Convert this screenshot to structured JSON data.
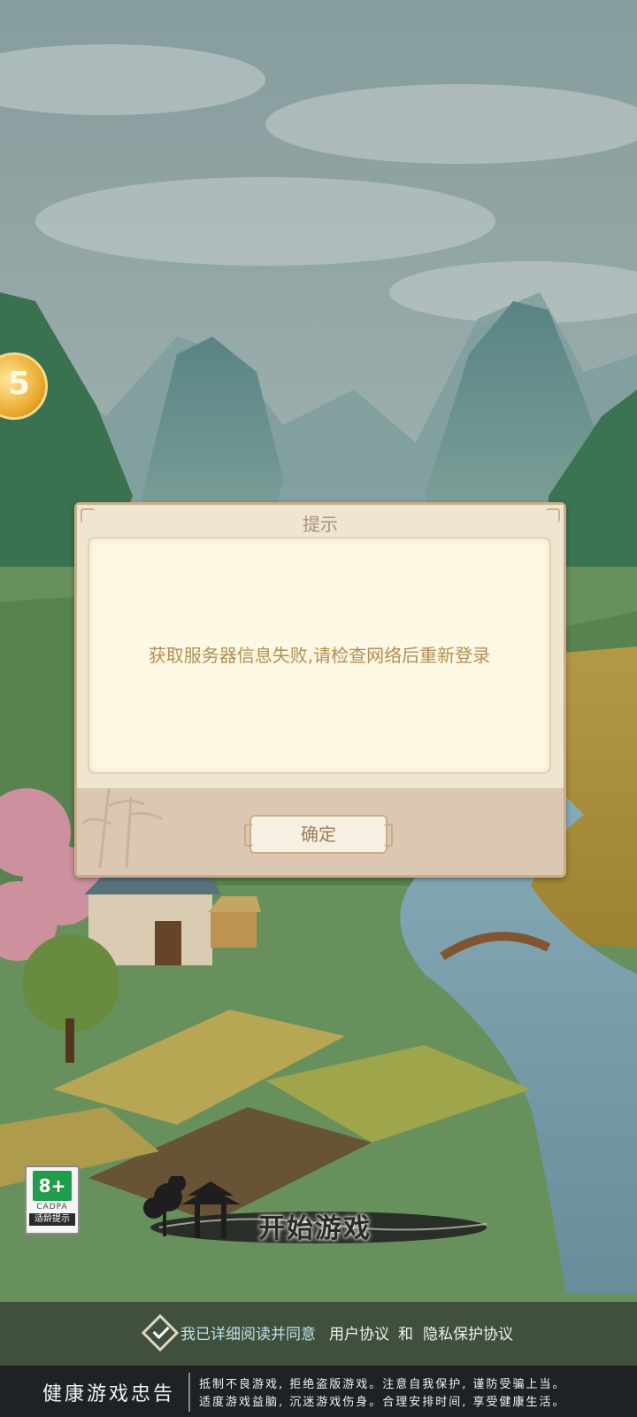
{
  "dialog": {
    "title": "提示",
    "message": "获取服务器信息失败,请检查网络后重新登录",
    "confirm_label": "确定"
  },
  "age_rating": {
    "age": "8+",
    "org": "CADPA",
    "tip": "适龄提示"
  },
  "start_button": {
    "label": "开始游戏"
  },
  "agreement": {
    "text": "我已详细阅读并同意",
    "user_agreement": "用户协议",
    "and": "和",
    "privacy_agreement": "隐私保护协议"
  },
  "health_notice": {
    "title": "健康游戏忠告",
    "line1": "抵制不良游戏, 拒绝盗版游戏。注意自我保护, 谨防受骗上当。",
    "line2": "适度游戏益脑, 沉迷游戏伤身。合理安排时间, 享受健康生活。"
  },
  "colors": {
    "dialog_bg": "#dcc8b2",
    "dialog_body": "#fdf8e4",
    "message_text": "#b58e52",
    "age_green": "#1f9d4c",
    "footer_bg": "#1f2224"
  },
  "icons": [
    "coin-icon",
    "checkbox-icon",
    "pavilion-decoration"
  ]
}
